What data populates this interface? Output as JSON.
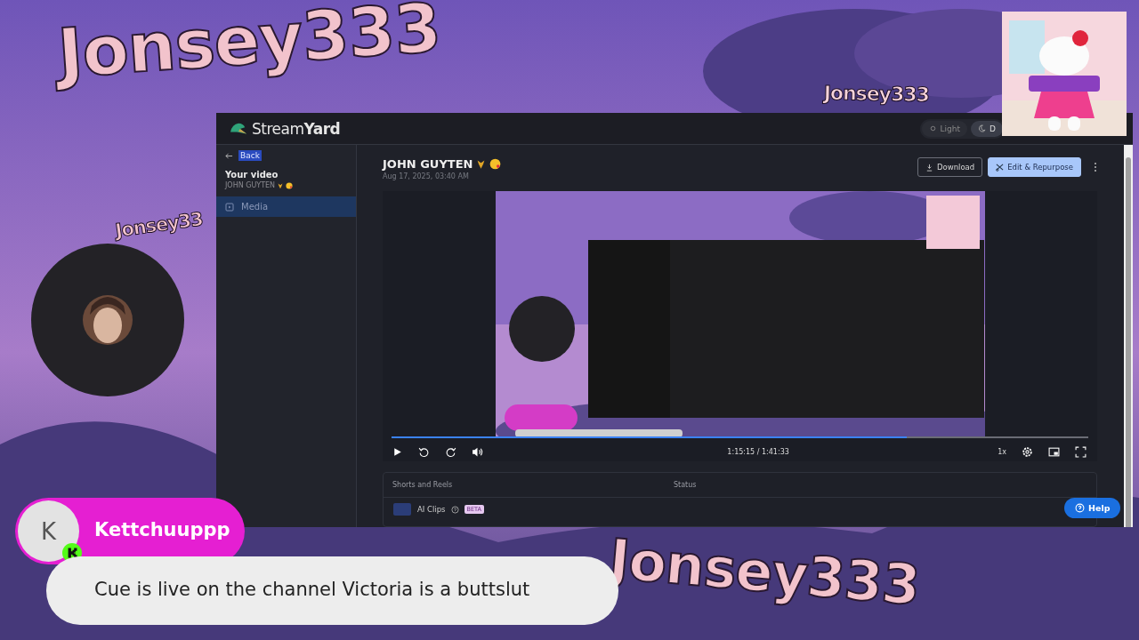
{
  "overlay_texts": [
    "Jonsey333",
    "Jonsey333",
    "Jonsey333",
    "Jonsey33"
  ],
  "app": {
    "logo": "Stream**Yard**",
    "theme_toggle": [
      {
        "label": "Light",
        "selected": false
      },
      {
        "label": "D",
        "selected": true
      }
    ],
    "sidebar": {
      "back": "Back",
      "section_title": "Your video",
      "section_subtitle": "JOHN GUYTEN",
      "items": [
        {
          "label": "Media",
          "selected": true
        }
      ]
    },
    "video": {
      "title": "JOHN GUYTEN",
      "date": "Aug 17, 2025, 03:40 AM",
      "buttons": [
        {
          "label": "Download",
          "kind": "outline"
        },
        {
          "label": "Edit & Repurpose",
          "kind": "primary"
        }
      ]
    },
    "player": {
      "level": 0.74,
      "time": "1:15:15 / 1:41:33",
      "speed": "1x"
    },
    "table": {
      "columns": [
        "Shorts and Reels",
        "Status"
      ],
      "rows": [
        {
          "name": "AI Clips",
          "badge": "BETA"
        }
      ]
    },
    "help": "Help"
  },
  "chat": {
    "avatar": "K",
    "user": "Kettchuuppp",
    "message": "Cue is live on the channel Victoria is a buttslut"
  }
}
